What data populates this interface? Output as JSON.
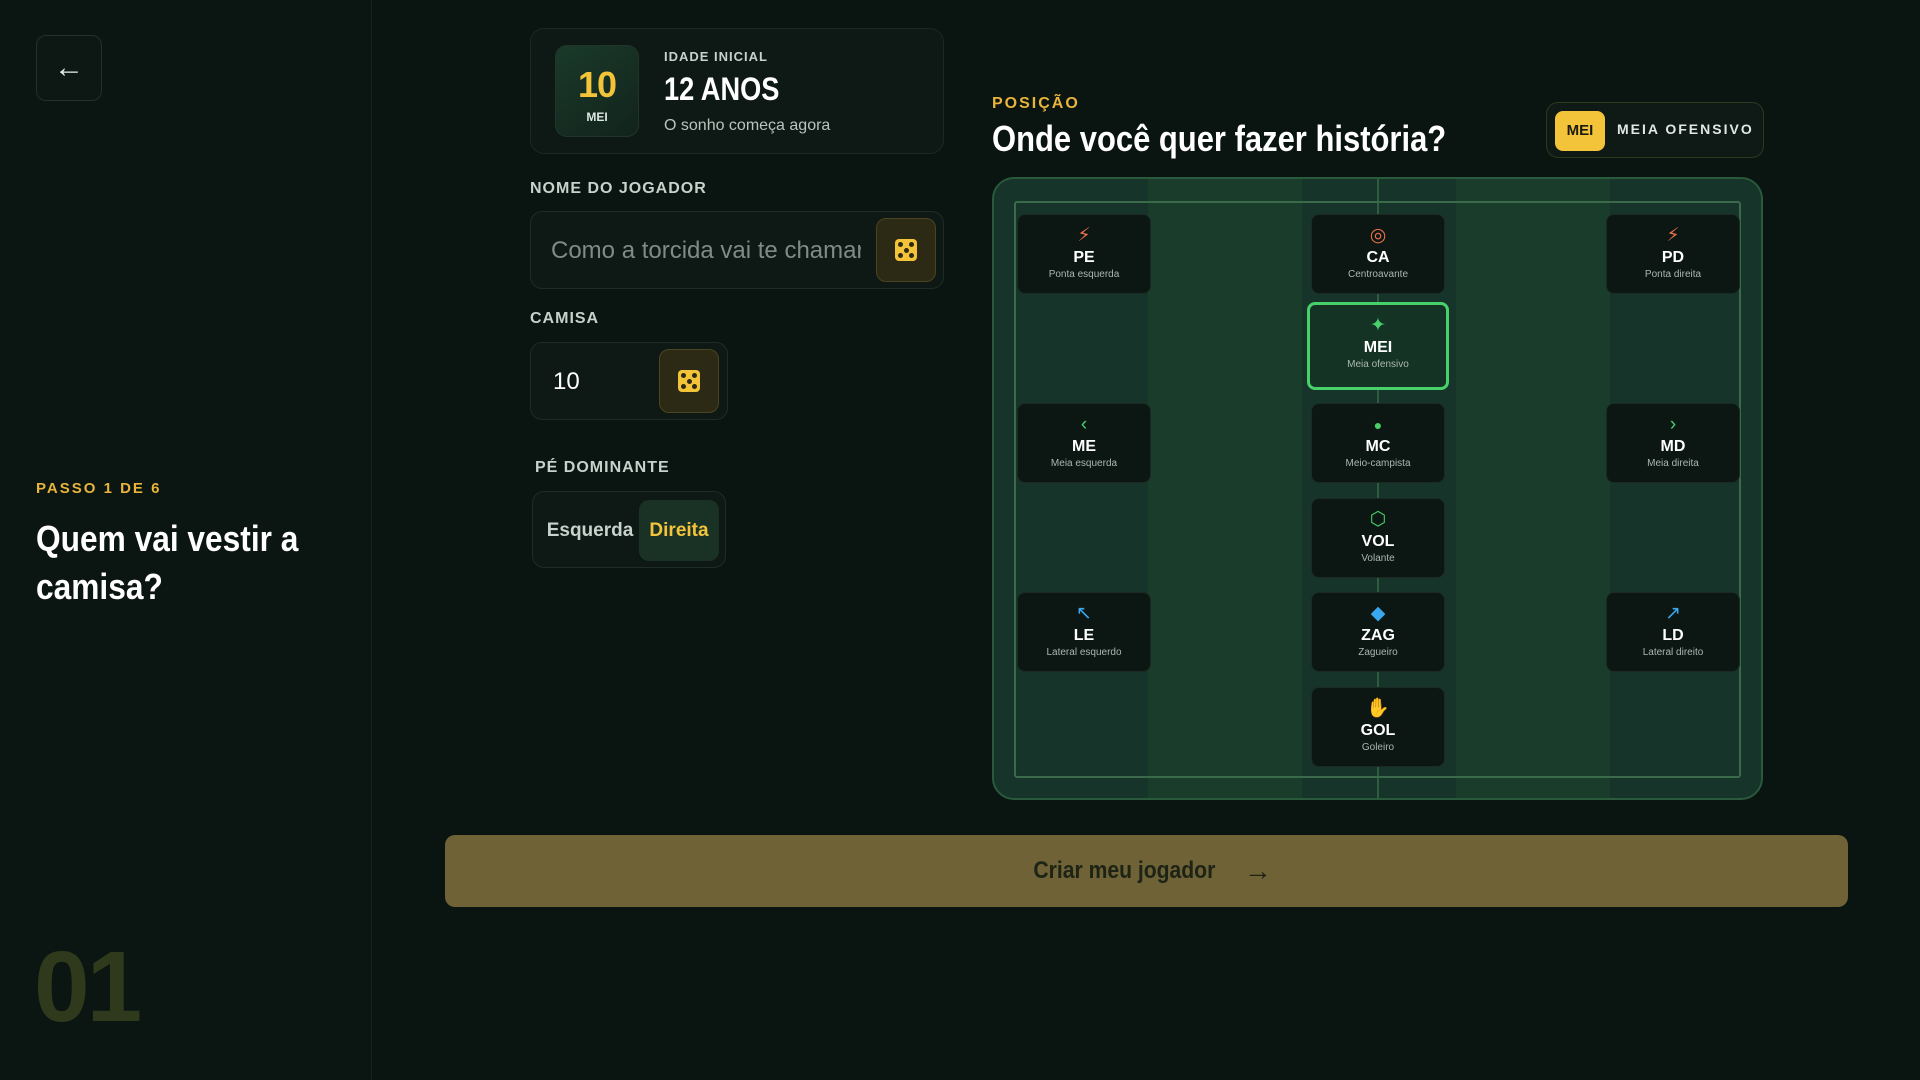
{
  "nav": {
    "back_icon": "←"
  },
  "step": {
    "label": "PASSO 1 DE 6",
    "title": "Quem vai vestir a camisa?",
    "big_number": "01"
  },
  "age_card": {
    "badge_number": "10",
    "badge_position": "MEI",
    "label": "IDADE INICIAL",
    "value": "12 ANOS",
    "subtitle": "O sonho começa agora"
  },
  "form": {
    "name_label": "NOME DO JOGADOR",
    "name_placeholder": "Como a torcida vai te chamar?",
    "name_value": "",
    "shirt_label": "CAMISA",
    "shirt_value": "10",
    "foot_label": "PÉ DOMINANTE",
    "foot_options": [
      "Esquerda",
      "Direita"
    ],
    "foot_selected": "Direita"
  },
  "position": {
    "label": "POSIÇÃO",
    "title": "Onde você quer fazer história?",
    "selected_code": "MEI",
    "selected_name": "MEIA OFENSIVO",
    "cards": [
      {
        "code": "PE",
        "name": "Ponta esquerda",
        "icon": "⚡",
        "icon_color": "#e8704a"
      },
      {
        "code": "CA",
        "name": "Centroavante",
        "icon": "◎",
        "icon_color": "#e8704a"
      },
      {
        "code": "PD",
        "name": "Ponta direita",
        "icon": "⚡",
        "icon_color": "#e8704a"
      },
      {
        "code": "MEI",
        "name": "Meia ofensivo",
        "icon": "✦",
        "icon_color": "#48d06a"
      },
      {
        "code": "ME",
        "name": "Meia esquerda",
        "icon": "‹",
        "icon_color": "#48d06a"
      },
      {
        "code": "MC",
        "name": "Meio-campista",
        "icon": "●",
        "icon_color": "#48d06a"
      },
      {
        "code": "MD",
        "name": "Meia direita",
        "icon": "›",
        "icon_color": "#48d06a"
      },
      {
        "code": "VOL",
        "name": "Volante",
        "icon": "⬡",
        "icon_color": "#48d06a"
      },
      {
        "code": "LE",
        "name": "Lateral esquerdo",
        "icon": "↖",
        "icon_color": "#3aa8f0"
      },
      {
        "code": "ZAG",
        "name": "Zagueiro",
        "icon": "◆",
        "icon_color": "#3aa8f0"
      },
      {
        "code": "LD",
        "name": "Lateral direito",
        "icon": "↗",
        "icon_color": "#3aa8f0"
      },
      {
        "code": "GOL",
        "name": "Goleiro",
        "icon": "✋",
        "icon_color": "#b04ae0"
      }
    ]
  },
  "cta": {
    "label": "Criar meu jogador",
    "arrow": "→"
  }
}
